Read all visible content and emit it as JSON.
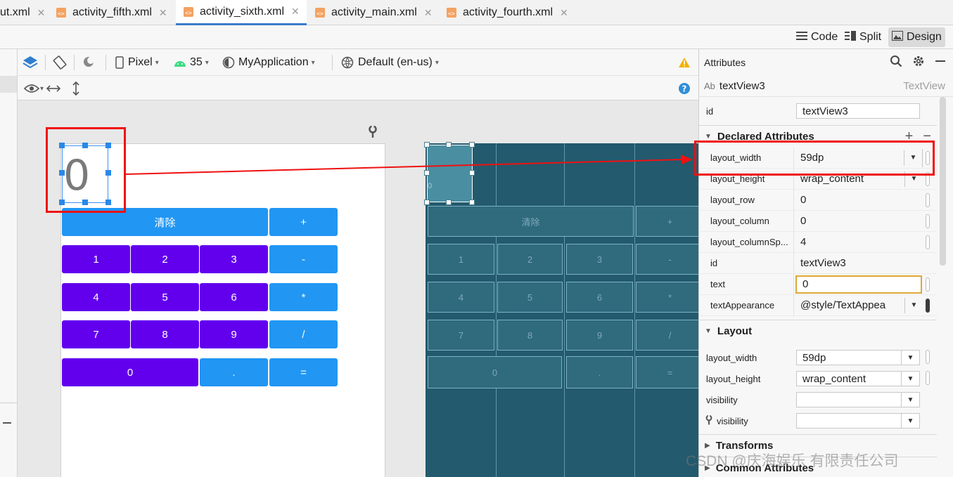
{
  "tabs": [
    {
      "label": "ut.xml"
    },
    {
      "label": "activity_fifth.xml"
    },
    {
      "label": "activity_sixth.xml"
    },
    {
      "label": "activity_main.xml"
    },
    {
      "label": "activity_fourth.xml"
    }
  ],
  "view_modes": {
    "code": "Code",
    "split": "Split",
    "design": "Design"
  },
  "toolbar": {
    "device": "Pixel",
    "api": "35",
    "theme": "MyApplication",
    "locale": "Default (en-us)"
  },
  "preview": {
    "display_text": "0",
    "buttons": {
      "clear": "清除",
      "plus": "+",
      "one": "1",
      "two": "2",
      "three": "3",
      "minus": "-",
      "four": "4",
      "five": "5",
      "six": "6",
      "multiply": "*",
      "seven": "7",
      "eight": "8",
      "nine": "9",
      "divide": "/",
      "zero": "0",
      "dot": ".",
      "equals": "="
    },
    "blueprint_display": "0"
  },
  "attributes": {
    "header": "Attributes",
    "component_name": "textView3",
    "component_class": "TextView",
    "component_icon": "Ab",
    "id_label": "id",
    "id_value": "textView3",
    "declared_title": "Declared Attributes",
    "declared": [
      {
        "name": "layout_width",
        "value": "59dp"
      },
      {
        "name": "layout_height",
        "value": "wrap_content"
      },
      {
        "name": "layout_row",
        "value": "0"
      },
      {
        "name": "layout_column",
        "value": "0"
      },
      {
        "name": "layout_columnSp...",
        "value": "4"
      },
      {
        "name": "id",
        "value": "textView3"
      },
      {
        "name": "text",
        "value": "0"
      },
      {
        "name": "textAppearance",
        "value": "@style/TextAppea"
      }
    ],
    "layout_title": "Layout",
    "layout": [
      {
        "name": "layout_width",
        "value": "59dp"
      },
      {
        "name": "layout_height",
        "value": "wrap_content"
      },
      {
        "name": "visibility",
        "value": ""
      },
      {
        "name": "visibility",
        "value": ""
      }
    ],
    "transforms_title": "Transforms",
    "common_title": "Common Attributes"
  },
  "watermark": "CSDN @庆海娱乐 有限责任公司",
  "colors": {
    "accent": "#3d7bc9",
    "purple_button": "#6200ee",
    "blue_button": "#2196f3",
    "annotation": "#ef1111",
    "blueprint": "#235a6e"
  }
}
